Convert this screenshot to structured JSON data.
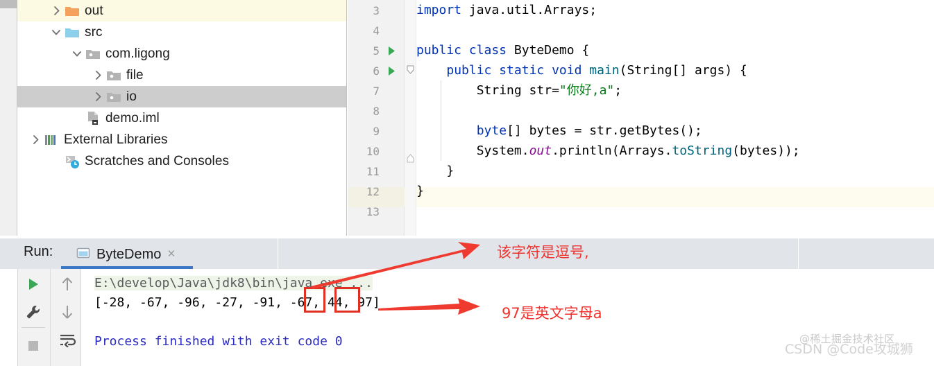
{
  "project_tree": {
    "items": [
      {
        "label": "out",
        "indent": 45,
        "chevron": "right",
        "icon": "folder-orange-icon",
        "highlight": "yellow"
      },
      {
        "label": "src",
        "indent": 45,
        "chevron": "down",
        "icon": "folder-blue-icon",
        "highlight": "none"
      },
      {
        "label": "com.ligong",
        "indent": 75,
        "chevron": "down",
        "icon": "package-icon",
        "highlight": "none"
      },
      {
        "label": "file",
        "indent": 105,
        "chevron": "right",
        "icon": "package-icon",
        "highlight": "none"
      },
      {
        "label": "io",
        "indent": 105,
        "chevron": "right",
        "icon": "package-icon",
        "highlight": "gray"
      },
      {
        "label": "demo.iml",
        "indent": 75,
        "chevron": "none",
        "icon": "iml-file-icon",
        "highlight": "none"
      },
      {
        "label": "External Libraries",
        "indent": 15,
        "chevron": "right",
        "icon": "libraries-icon",
        "highlight": "none"
      },
      {
        "label": "Scratches and Consoles",
        "indent": 45,
        "chevron": "none",
        "icon": "scratches-icon",
        "highlight": "none"
      }
    ]
  },
  "editor": {
    "lines": [
      {
        "num": "3",
        "runnable": false,
        "tokens": [
          {
            "t": "import ",
            "c": "kw"
          },
          {
            "t": "java.util.Arrays;",
            "c": ""
          }
        ],
        "indent": 0
      },
      {
        "num": "4",
        "runnable": false,
        "tokens": [],
        "indent": 0
      },
      {
        "num": "5",
        "runnable": true,
        "tokens": [
          {
            "t": "public class ",
            "c": "kw"
          },
          {
            "t": "ByteDemo {",
            "c": ""
          }
        ],
        "indent": 0
      },
      {
        "num": "6",
        "runnable": true,
        "tokens": [
          {
            "t": "    ",
            "c": ""
          },
          {
            "t": "public static void ",
            "c": "kw"
          },
          {
            "t": "main",
            "c": "mtd"
          },
          {
            "t": "(String[] args) {",
            "c": ""
          }
        ],
        "indent": 0
      },
      {
        "num": "7",
        "runnable": false,
        "tokens": [
          {
            "t": "        String str=",
            "c": ""
          },
          {
            "t": "\"你好,a\"",
            "c": "str"
          },
          {
            "t": ";",
            "c": ""
          }
        ],
        "indent": 0
      },
      {
        "num": "8",
        "runnable": false,
        "tokens": [],
        "indent": 0
      },
      {
        "num": "9",
        "runnable": false,
        "tokens": [
          {
            "t": "        ",
            "c": ""
          },
          {
            "t": "byte",
            "c": "kw"
          },
          {
            "t": "[] bytes = str.getBytes();",
            "c": ""
          }
        ],
        "indent": 0
      },
      {
        "num": "10",
        "runnable": false,
        "tokens": [
          {
            "t": "        System.",
            "c": ""
          },
          {
            "t": "out",
            "c": "fld"
          },
          {
            "t": ".println(Arrays.",
            "c": ""
          },
          {
            "t": "toString",
            "c": "mtd"
          },
          {
            "t": "(bytes));",
            "c": ""
          }
        ],
        "indent": 0
      },
      {
        "num": "11",
        "runnable": false,
        "tokens": [
          {
            "t": "    }",
            "c": ""
          }
        ],
        "indent": 0
      },
      {
        "num": "12",
        "runnable": false,
        "tokens": [
          {
            "t": "}",
            "c": ""
          }
        ],
        "indent": 0
      },
      {
        "num": "13",
        "runnable": false,
        "tokens": [],
        "indent": 0
      }
    ],
    "caret_line": "13"
  },
  "run_panel": {
    "label": "Run:",
    "tab_name": "ByteDemo",
    "close_label": "×",
    "toolbar": {
      "rerun": "run-icon",
      "settings": "wrench-icon",
      "stop": "stop-icon",
      "up": "arrow-up-icon",
      "down": "arrow-down-icon",
      "wrap": "soft-wrap-icon"
    },
    "console": {
      "command_line": "E:\\develop\\Java\\jdk8\\bin\\java.exe ...",
      "output_line": "[-28, -67, -96, -27, -91, -67, 44, 97]",
      "exit_line": "Process finished with exit code 0"
    }
  },
  "annotations": {
    "accent_color": "#f0322c",
    "note_comma": "该字符是逗号,",
    "note_letter": "97是英文字母a",
    "highlight_boxes": [
      "44",
      "97"
    ]
  },
  "watermark": {
    "line_a": "@稀土掘金技术社区",
    "line_b": "CSDN @Code攻城狮"
  }
}
